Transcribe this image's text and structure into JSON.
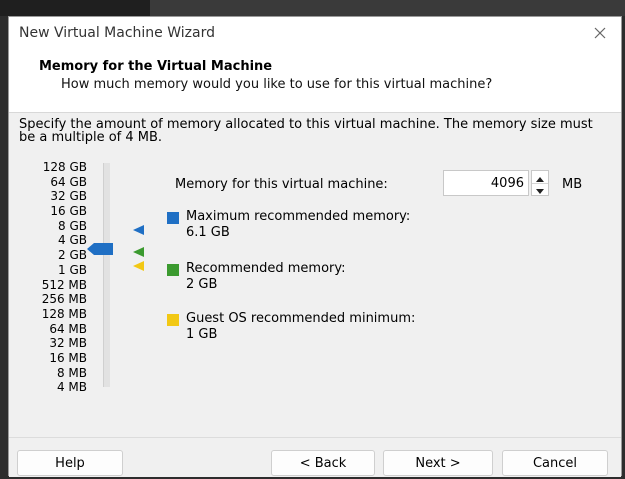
{
  "window": {
    "title": "New Virtual Machine Wizard"
  },
  "header": {
    "title": "Memory for the Virtual Machine",
    "subtitle": "How much memory would you like to use for this virtual machine?"
  },
  "description": "Specify the amount of memory allocated to this virtual machine. The memory size must be a multiple of 4 MB.",
  "scale_labels": [
    "128 GB",
    "64 GB",
    "32 GB",
    "16 GB",
    "8 GB",
    "4 GB",
    "2 GB",
    "1 GB",
    "512 MB",
    "256 MB",
    "128 MB",
    "64 MB",
    "32 MB",
    "16 MB",
    "8 MB",
    "4 MB"
  ],
  "slider": {
    "selected_label": "4 GB"
  },
  "memory": {
    "label": "Memory for this virtual machine:",
    "value": "4096",
    "unit": "MB"
  },
  "recommendations": [
    {
      "label": "Maximum recommended memory:",
      "value": "6.1 GB",
      "color": "#1f6fc4"
    },
    {
      "label": "Recommended memory:",
      "value": "2 GB",
      "color": "#3b9a2f"
    },
    {
      "label": "Guest OS recommended minimum:",
      "value": "1 GB",
      "color": "#f2c814"
    }
  ],
  "buttons": {
    "help": "Help",
    "back": "< Back",
    "next": "Next >",
    "cancel": "Cancel"
  },
  "colors": {
    "thumb": "#1f6fc4",
    "dialog_bg": "#f0f0f0"
  }
}
